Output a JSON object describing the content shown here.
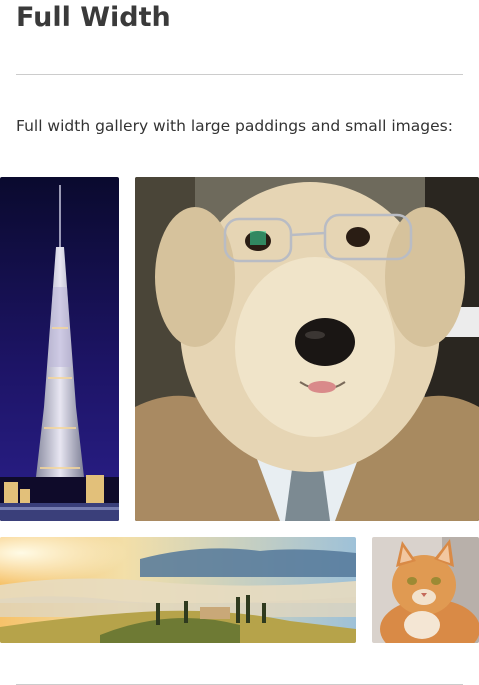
{
  "page": {
    "title": "Full Width",
    "intro": "Full width gallery with large paddings and small images:"
  },
  "gallery": {
    "items": [
      {
        "subject": "burj-khalifa-tower-at-night"
      },
      {
        "subject": "golden-retriever-in-glasses-and-suit"
      },
      {
        "subject": "misty-tuscan-hills-at-sunrise"
      },
      {
        "subject": "ginger-tabby-cat"
      }
    ]
  },
  "colors": {
    "title": "#3a3a3a",
    "text": "#333333",
    "rule": "#cccccc",
    "background": "#ffffff"
  }
}
